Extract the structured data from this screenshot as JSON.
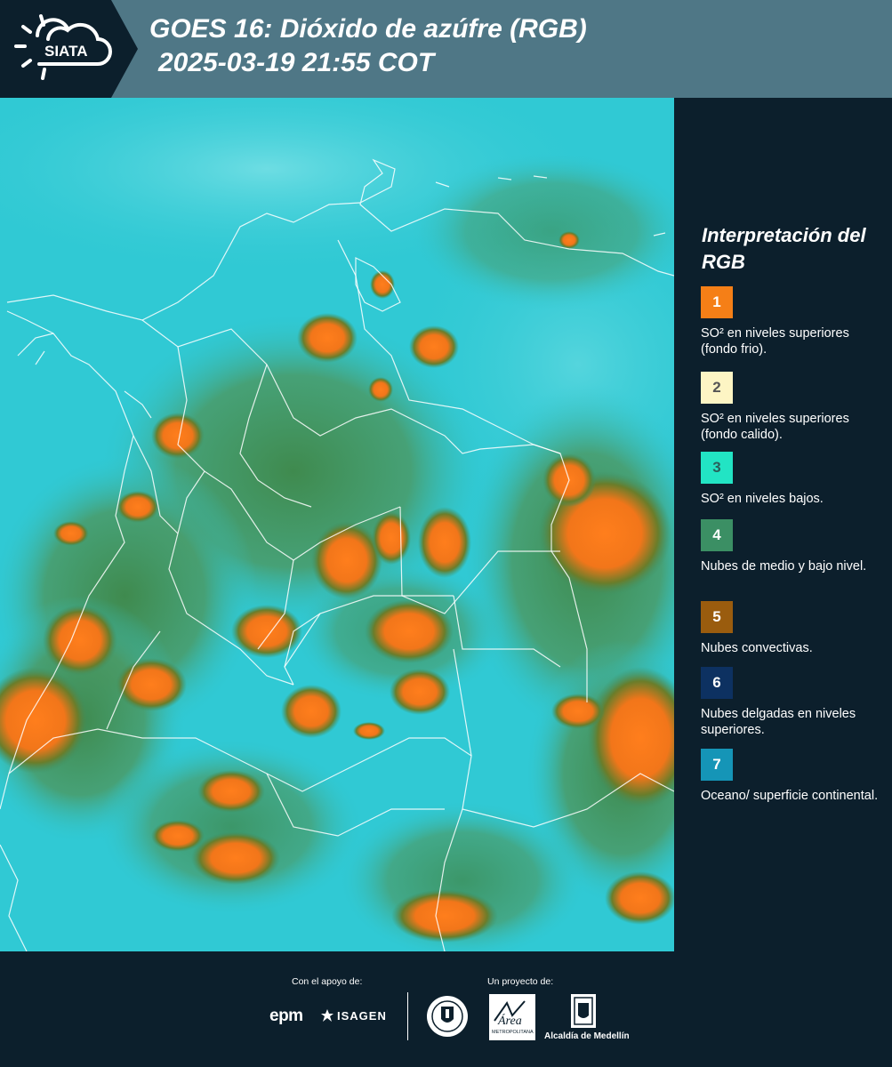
{
  "header": {
    "logo_text": "SIATA",
    "title_line1": "GOES 16: Dióxido de azúfre (RGB)",
    "title_line2": "2025-03-19 21:55 COT"
  },
  "legend": {
    "title": "Interpretación del RGB",
    "items": [
      {
        "number": "1",
        "color": "#f57f17",
        "label": "SO² en niveles superiores (fondo frio)."
      },
      {
        "number": "2",
        "color": "#fdf5c4",
        "label": "SO² en niveles superiores (fondo calido)."
      },
      {
        "number": "3",
        "color": "#22e4c4",
        "label": "SO² en niveles bajos."
      },
      {
        "number": "4",
        "color": "#3b8f64",
        "label": "Nubes de medio y bajo nivel."
      },
      {
        "number": "5",
        "color": "#9a5c0e",
        "label": "Nubes convectivas."
      },
      {
        "number": "6",
        "color": "#0d3161",
        "label": "Nubes delgadas en niveles superiores."
      },
      {
        "number": "7",
        "color": "#1595b7",
        "label": "Oceano/ superficie continental."
      }
    ]
  },
  "footer": {
    "support_label": "Con el apoyo de:",
    "project_label": "Un proyecto de:",
    "epm": "epm",
    "isagen": "ISAGEN",
    "amva": "Área",
    "amva_sub": "METROPOLITANA",
    "alcaldia": "Alcaldía de Medellín"
  },
  "colors": {
    "header_bg": "#4f7786",
    "panel_bg": "#0c1f2c",
    "sea": "#30c9d4",
    "cloud": "#f57f17",
    "land_cloud": "#3b8f64"
  }
}
